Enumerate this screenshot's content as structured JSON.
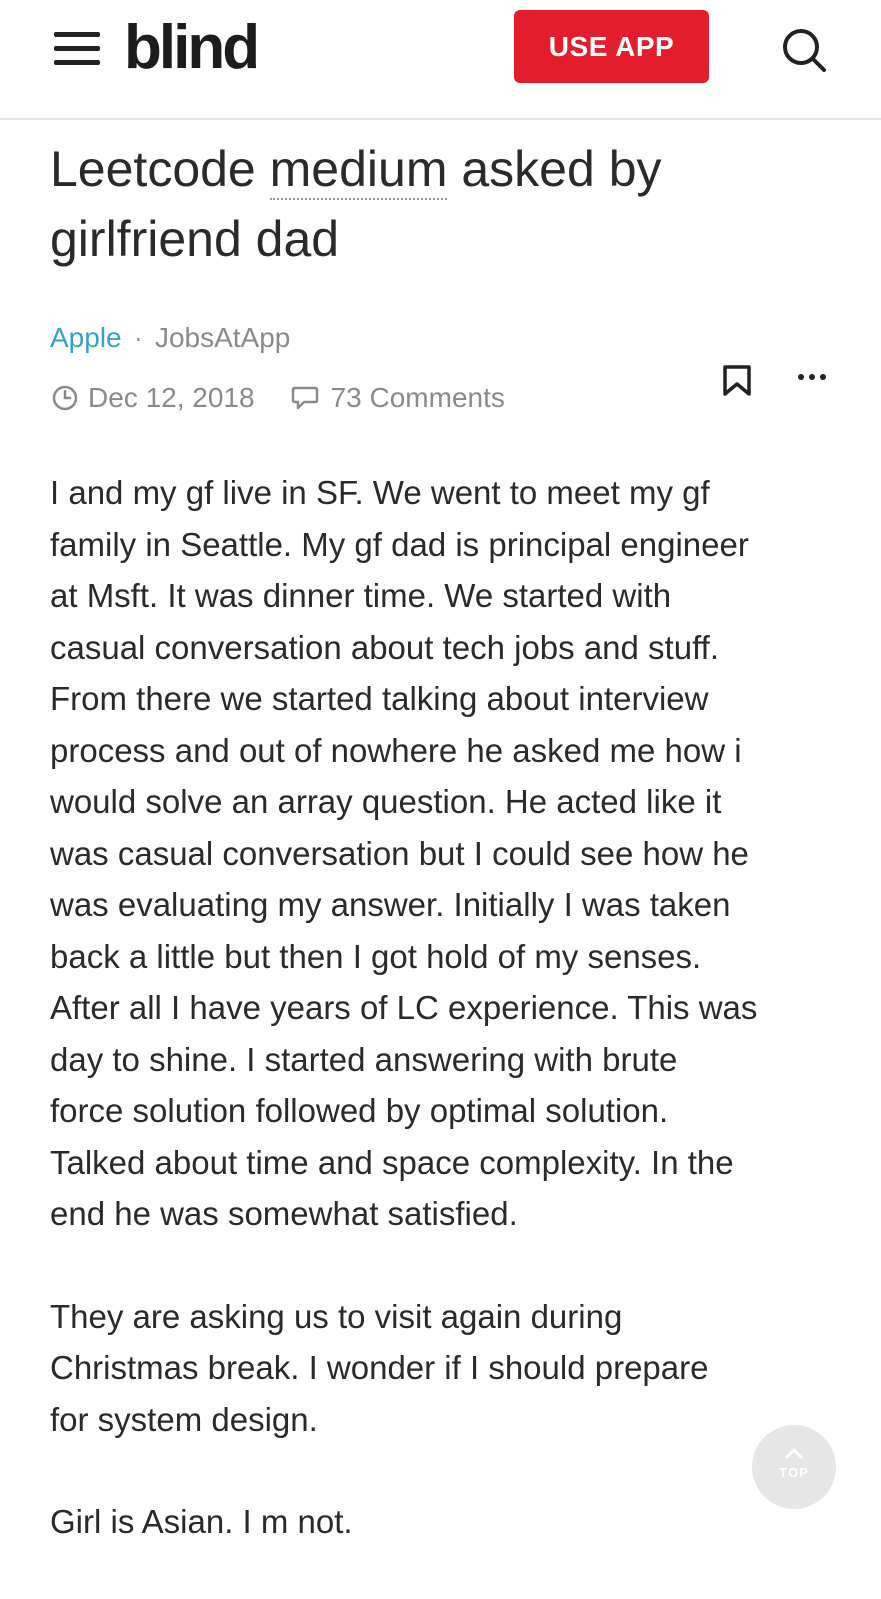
{
  "header": {
    "logo": "blind",
    "use_app_label": "USE APP",
    "icons": {
      "menu": "hamburger-menu-icon",
      "search": "search-icon"
    }
  },
  "post": {
    "title_part1": "Leetcode ",
    "title_highlight": "medium",
    "title_part2": " asked by girlfriend dad",
    "company": "Apple",
    "separator": "·",
    "author": "JobsAtApp",
    "date": "Dec 12, 2018",
    "comments": "73 Comments",
    "paragraphs": [
      "I and my gf live in SF. We went to meet my gf\nfamily in Seattle. My gf dad is principal engineer\nat Msft. It was dinner time. We started with\ncasual conversation about tech jobs and stuff.\nFrom there we started talking about interview\nprocess and out of nowhere he asked me how i\nwould solve an array question. He acted like it\nwas casual conversation but I could see how he\nwas evaluating my answer. Initially I was taken\nback a little but then I got hold of my senses.\nAfter all I have years of LC experience. This was\nday to shine. I started answering with brute\nforce solution followed by optimal solution.\nTalked about time and space complexity. In the\nend he was somewhat satisfied.",
      "They are asking us to visit again during\nChristmas break. I wonder if I should prepare\nfor system design.",
      "Girl is Asian. I m not."
    ]
  },
  "scroll_top": {
    "label": "TOP"
  },
  "colors": {
    "brand_red": "#e31d2b",
    "company_link": "#3aa0c8",
    "meta_gray": "#8a8a8a",
    "text": "#2a2a2a"
  }
}
